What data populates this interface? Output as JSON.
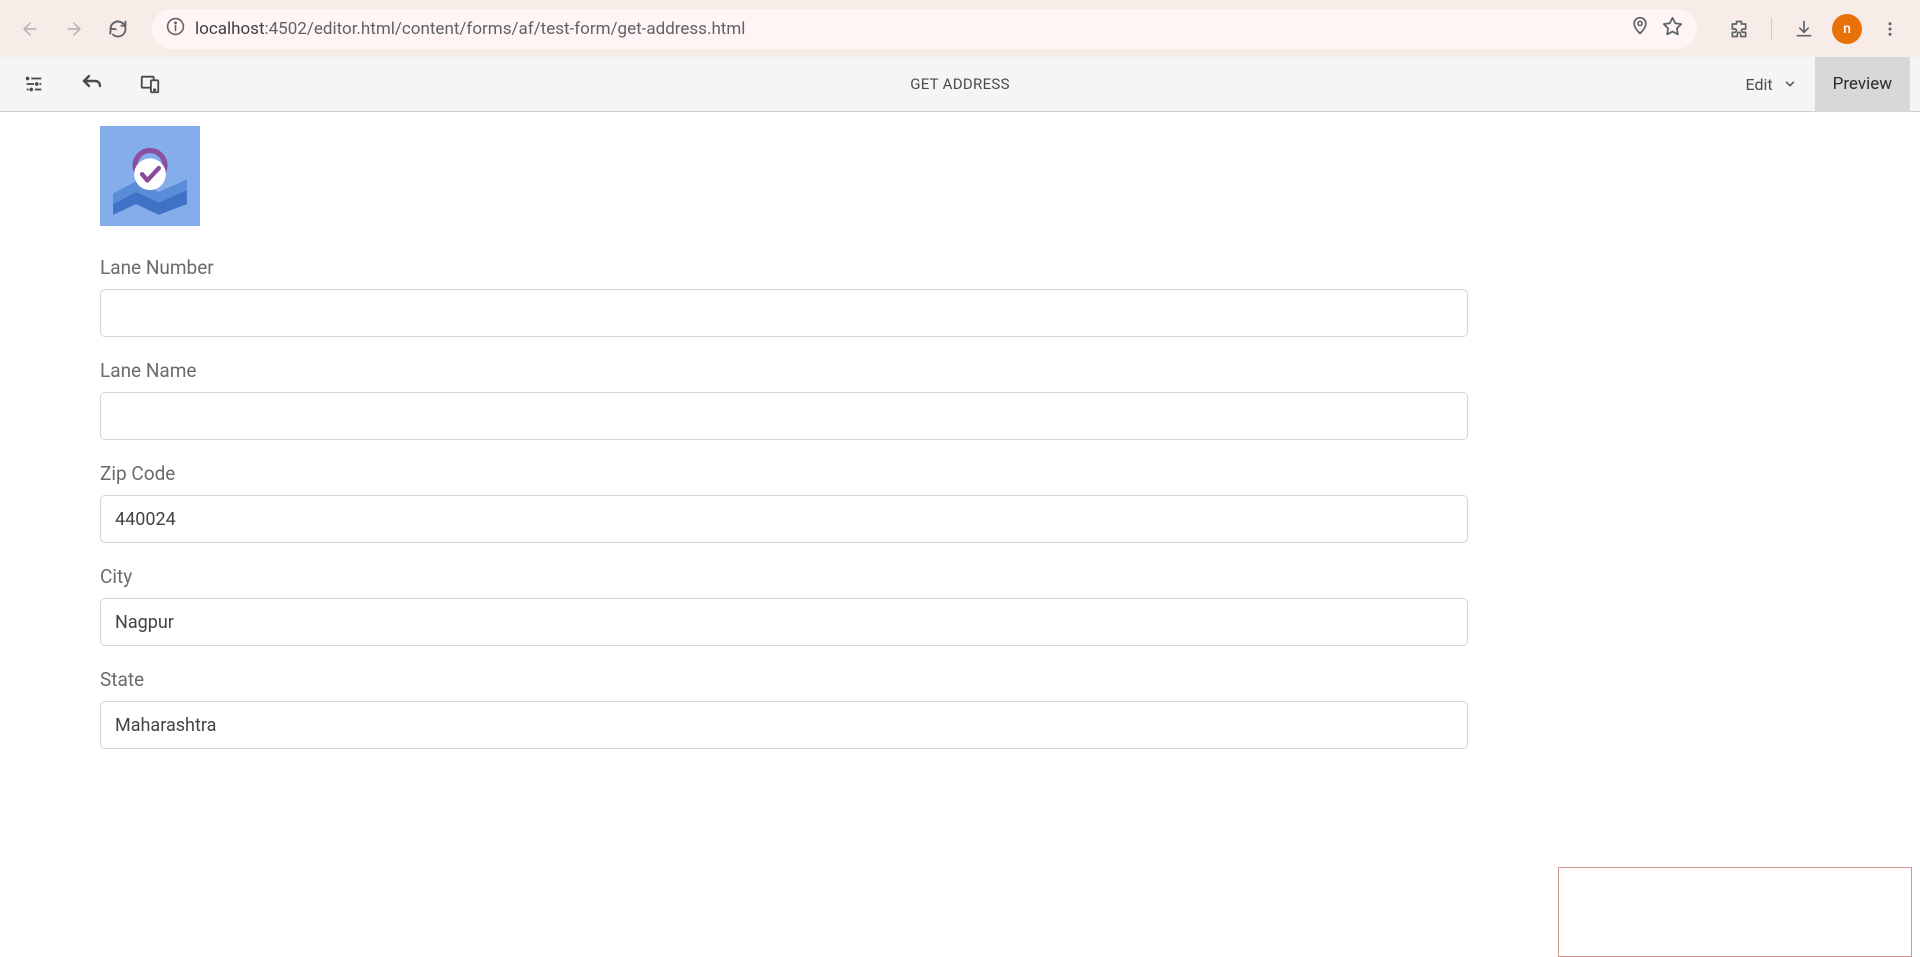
{
  "browser": {
    "url_host_label": "localhost",
    "url_port_and_path": ":4502/editor.html/content/forms/af/test-form/get-address.html",
    "avatar_letter": "n"
  },
  "toolbar": {
    "page_title": "GET ADDRESS",
    "edit_label": "Edit",
    "preview_label": "Preview"
  },
  "form": {
    "fields": [
      {
        "label": "Lane Number",
        "value": ""
      },
      {
        "label": "Lane Name",
        "value": ""
      },
      {
        "label": "Zip Code",
        "value": "440024"
      },
      {
        "label": "City",
        "value": "Nagpur"
      },
      {
        "label": "State",
        "value": "Maharashtra"
      }
    ]
  }
}
